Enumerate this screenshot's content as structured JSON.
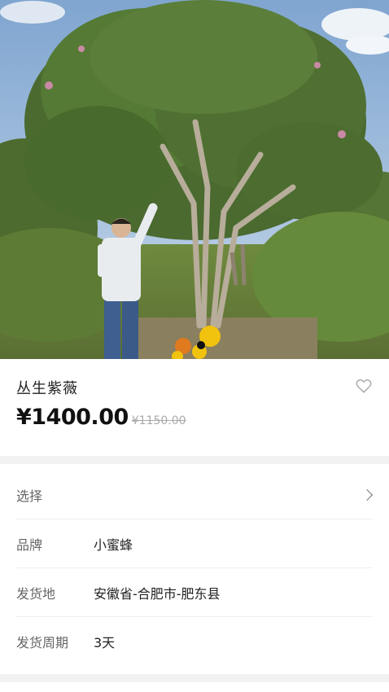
{
  "product": {
    "title": "丛生紫薇",
    "price": "¥1400.00",
    "original_price": "¥1150.00",
    "favorite_icon": "heart-outline-icon"
  },
  "specs": {
    "select": {
      "label": "选择",
      "value": "",
      "icon": "chevron-right-icon"
    },
    "brand": {
      "label": "品牌",
      "value": "小蜜蜂"
    },
    "origin": {
      "label": "发货地",
      "value": "安徽省-合肥市-肥东县"
    },
    "delivery": {
      "label": "发货周期",
      "value": "3天"
    }
  },
  "colors": {
    "page_background": "#f2f2f2",
    "card_background": "#ffffff",
    "strikethrough_text": "#aaaaaa"
  }
}
